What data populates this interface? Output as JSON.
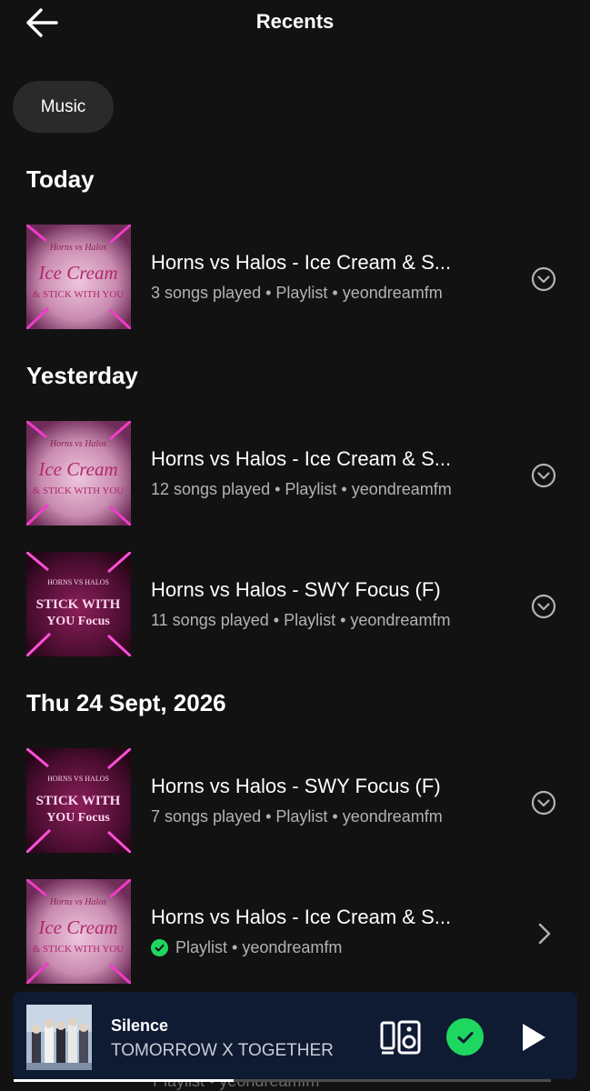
{
  "header": {
    "title": "Recents",
    "back_icon": "arrow-left-icon"
  },
  "filter": {
    "chip_label": "Music"
  },
  "sections": [
    {
      "title": "Today"
    },
    {
      "title": "Yesterday"
    },
    {
      "title": "Thu 24 Sept, 2026"
    }
  ],
  "items": [
    {
      "title": "Horns vs Halos -  Ice Cream & S...",
      "subtitle": "3 songs played • Playlist • yeondreamfm",
      "art": {
        "line1": "Horns vs Halos",
        "line2": "Ice Cream",
        "line3": "& STICK WITH YOU"
      },
      "action_icon": "chevron-down-circle-icon"
    },
    {
      "title": "Horns vs Halos -  Ice Cream & S...",
      "subtitle": "12 songs played • Playlist • yeondreamfm",
      "art": {
        "line1": "Horns vs Halos",
        "line2": "Ice Cream",
        "line3": "& STICK WITH YOU"
      },
      "action_icon": "chevron-down-circle-icon"
    },
    {
      "title": "Horns vs Halos - SWY  Focus (F)",
      "subtitle": "11 songs played • Playlist • yeondreamfm",
      "art": {
        "line1": "HORNS VS HALOS",
        "line2": "STICK WITH",
        "line3": "YOU Focus"
      },
      "action_icon": "chevron-down-circle-icon"
    },
    {
      "title": "Horns vs Halos - SWY  Focus (F)",
      "subtitle": "7 songs played • Playlist • yeondreamfm",
      "art": {
        "line1": "HORNS VS HALOS",
        "line2": "STICK WITH",
        "line3": "YOU Focus"
      },
      "action_icon": "chevron-down-circle-icon"
    },
    {
      "title": "Horns vs Halos -  Ice Cream & S...",
      "subtitle": "Playlist • yeondreamfm",
      "art": {
        "line1": "Horns vs Halos",
        "line2": "Ice Cream",
        "line3": "& STICK WITH YOU"
      },
      "action_icon": "chevron-right-icon",
      "downloaded_icon": "check-circle-icon"
    }
  ],
  "ghost_row_text": "Playlist • yeondreamfm",
  "now_playing": {
    "title": "Silence",
    "artist": "TOMORROW X TOGETHER",
    "progress": 0.41,
    "icons": [
      "devices-icon",
      "saved-check-icon",
      "play-icon"
    ]
  },
  "colors": {
    "background": "#121212",
    "accent": "#1ed760",
    "player_bg": "#0f1a33",
    "secondary_text": "#b3b3b3"
  }
}
